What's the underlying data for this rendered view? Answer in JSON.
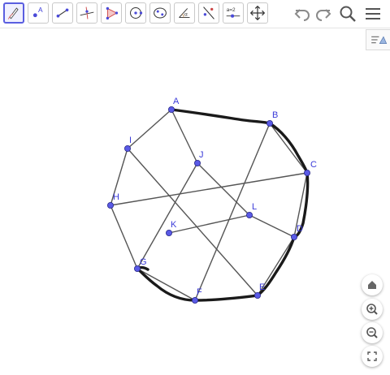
{
  "toolbar": {
    "tools": [
      {
        "name": "pen-tool",
        "active": true
      },
      {
        "name": "point-tool",
        "label": "A"
      },
      {
        "name": "line-tool"
      },
      {
        "name": "perpendicular-line-tool"
      },
      {
        "name": "polygon-tool"
      },
      {
        "name": "circle-tool"
      },
      {
        "name": "conic-tool"
      },
      {
        "name": "angle-tool",
        "label": "α"
      },
      {
        "name": "reflect-tool"
      },
      {
        "name": "slider-tool",
        "label": "a=2"
      },
      {
        "name": "move-graphics-tool"
      }
    ],
    "right_icons": [
      "undo-icon",
      "redo-icon",
      "search-icon",
      "menu-icon"
    ]
  },
  "graphics": {
    "point_color": "#5a5ae6",
    "label_color": "#3a3ad8",
    "points": [
      {
        "label": "A"
      },
      {
        "label": "B"
      },
      {
        "label": "C"
      },
      {
        "label": "D"
      },
      {
        "label": "E"
      },
      {
        "label": "F"
      },
      {
        "label": "G"
      },
      {
        "label": "H"
      },
      {
        "label": "I"
      },
      {
        "label": "J"
      },
      {
        "label": "K"
      },
      {
        "label": "L"
      }
    ],
    "segments": [
      [
        "A",
        "I"
      ],
      [
        "I",
        "H"
      ],
      [
        "H",
        "G"
      ],
      [
        "G",
        "F"
      ],
      [
        "A",
        "J"
      ],
      [
        "J",
        "L"
      ],
      [
        "L",
        "D"
      ],
      [
        "B",
        "C"
      ],
      [
        "C",
        "D"
      ],
      [
        "I",
        "E"
      ],
      [
        "B",
        "F"
      ],
      [
        "H",
        "C"
      ],
      [
        "K",
        "L"
      ],
      [
        "J",
        "G"
      ],
      [
        "D",
        "E"
      ]
    ],
    "freehand_stroke_color": "#1a1a1a"
  },
  "zoom_controls": [
    "home-icon",
    "zoom-in-icon",
    "zoom-out-icon",
    "fullscreen-icon"
  ]
}
